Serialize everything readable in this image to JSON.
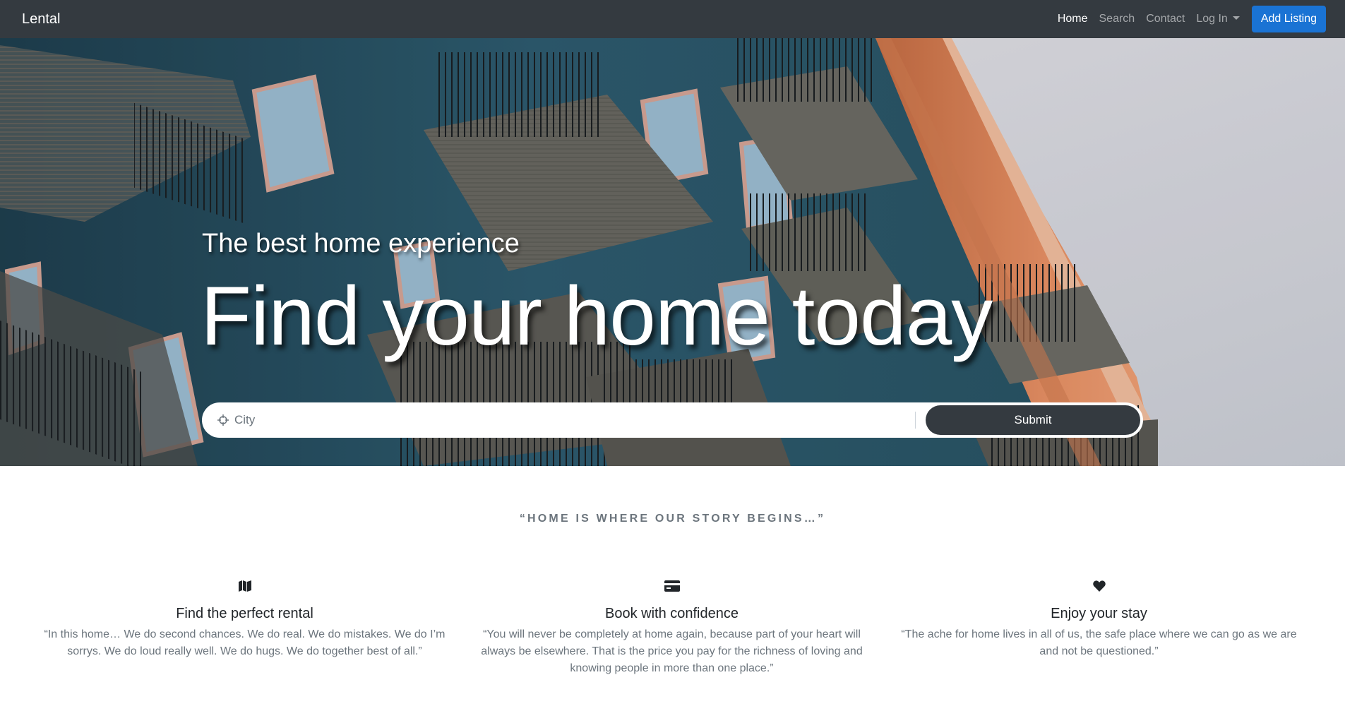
{
  "navbar": {
    "brand": "Lental",
    "links": [
      {
        "label": "Home",
        "active": true
      },
      {
        "label": "Search",
        "active": false
      },
      {
        "label": "Contact",
        "active": false
      },
      {
        "label": "Log In",
        "active": false
      }
    ],
    "add_listing_label": "Add Listing"
  },
  "hero": {
    "subtitle": "The best home experience",
    "title": "Find your home today",
    "search": {
      "placeholder": "City",
      "icon": "crosshair-icon",
      "submit_label": "Submit"
    }
  },
  "quote": "“HOME IS WHERE OUR STORY BEGINS…”",
  "features": [
    {
      "icon": "map-icon",
      "title": "Find the perfect rental",
      "text": "“In this home… We do second chances. We do real. We do mistakes. We do I’m sorrys. We do loud really well. We do hugs. We do together best of all.”"
    },
    {
      "icon": "credit-card-icon",
      "title": "Book with confidence",
      "text": "“You will never be completely at home again, because part of your heart will always be elsewhere. That is the price you pay for the richness of loving and knowing people in more than one place.”"
    },
    {
      "icon": "heart-icon",
      "title": "Enjoy your stay",
      "text": "“The ache for home lives in all of us, the safe place where we can go as we are and not be questioned.”"
    }
  ],
  "colors": {
    "navbar_bg": "#343a40",
    "accent": "#1a73d4",
    "building_wall": "#2f5b6e",
    "building_orange": "#e48a5a",
    "sky": "#dfe0e6"
  }
}
